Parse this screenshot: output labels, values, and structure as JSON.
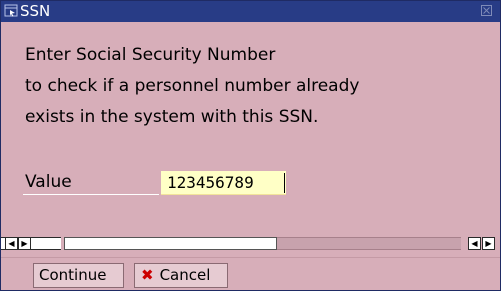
{
  "dialog": {
    "title": "SSN",
    "message_lines": [
      "Enter Social Security Number",
      "to check if a personnel number already",
      "exists in the system with this SSN."
    ],
    "field": {
      "label": "Value",
      "value": "123456789"
    }
  },
  "footer": {
    "continue_label": "Continue",
    "cancel_label": "Cancel"
  },
  "colors": {
    "titlebar": "#283c86",
    "dialog_background": "#d7aeb9",
    "input_background": "#ffffc6",
    "cancel_icon": "#cc0000"
  },
  "icons": {
    "title": "dialog-window-icon",
    "close": "close-icon",
    "scroll_left": "scroll-left-arrow-icon",
    "scroll_right": "scroll-right-arrow-icon",
    "cancel": "cancel-x-icon"
  }
}
